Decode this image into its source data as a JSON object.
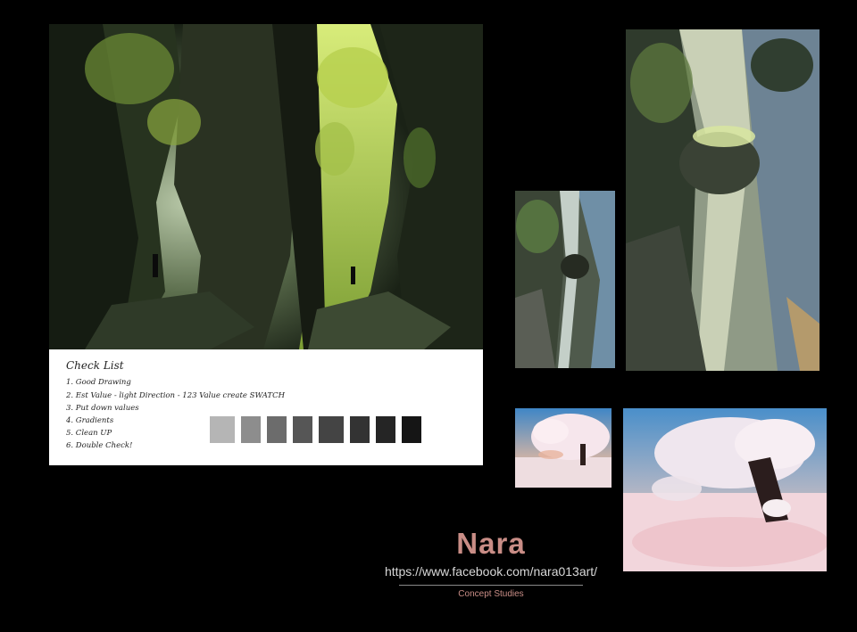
{
  "checklist": {
    "title": "Check List",
    "items": [
      "1. Good Drawing",
      "2. Est Value - light Direction - 123 Value create SWATCH",
      "3. Put down values",
      "4. Gradients",
      "5. Clean UP",
      "6. Double Check!"
    ],
    "swatches": [
      "#b5b5b5",
      "#8d8d8d",
      "#6c6c6c",
      "#565656",
      "#444444",
      "#333333",
      "#252525",
      "#151515"
    ]
  },
  "branding": {
    "name": "Nara",
    "url": "https://www.facebook.com/nara013art/",
    "tagline": "Concept Studies"
  },
  "colors": {
    "background": "#000000",
    "accent": "#c98d86"
  }
}
